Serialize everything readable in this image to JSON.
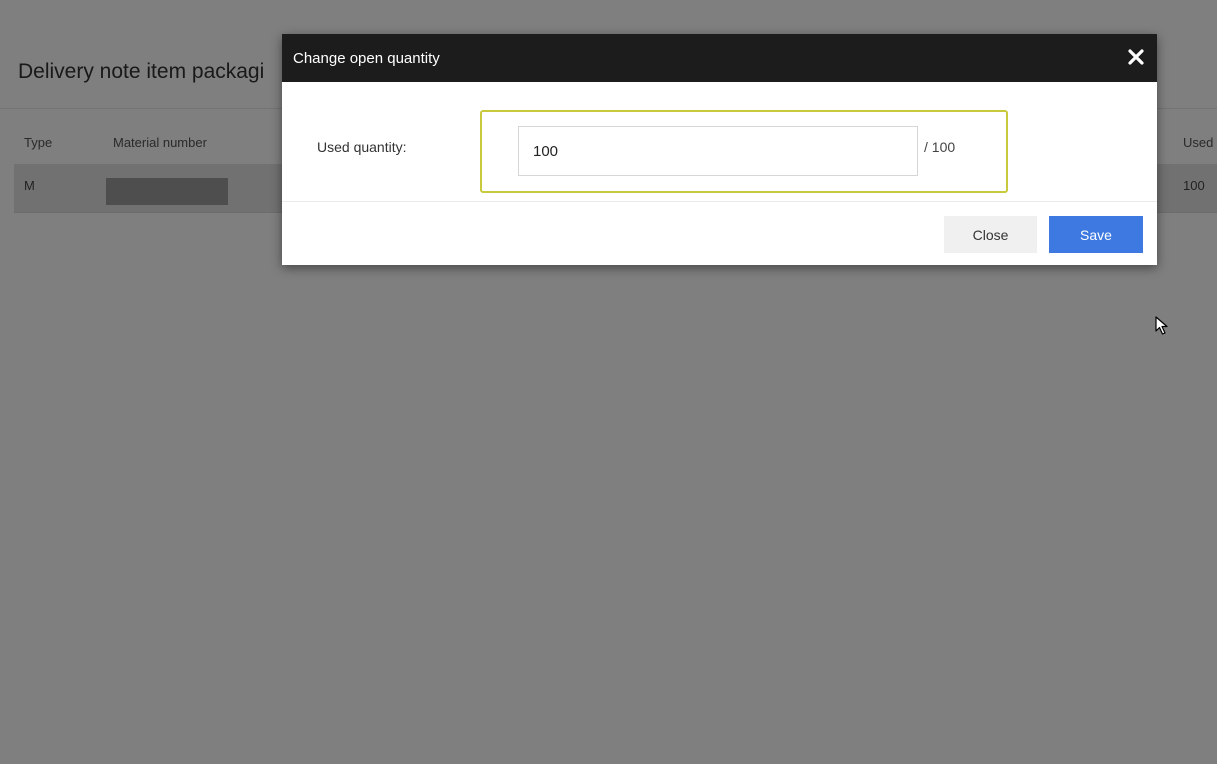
{
  "background_page": {
    "title": "Delivery note item packagi",
    "columns": [
      "Type",
      "Material number",
      "Used"
    ],
    "rows": [
      {
        "type": "M",
        "used": "100"
      }
    ]
  },
  "modal": {
    "title": "Change open quantity",
    "close_icon": "close-icon",
    "field_label": "Used quantity:",
    "quantity_value": "100",
    "quantity_total": "/ 100",
    "buttons": {
      "close_label": "Close",
      "save_label": "Save"
    }
  },
  "colors": {
    "modal_header_bg": "#1c1c1c",
    "save_button_bg": "#3d79e0",
    "highlight_border": "#c9c93d",
    "overlay": "rgba(0,0,0,0.5)"
  }
}
